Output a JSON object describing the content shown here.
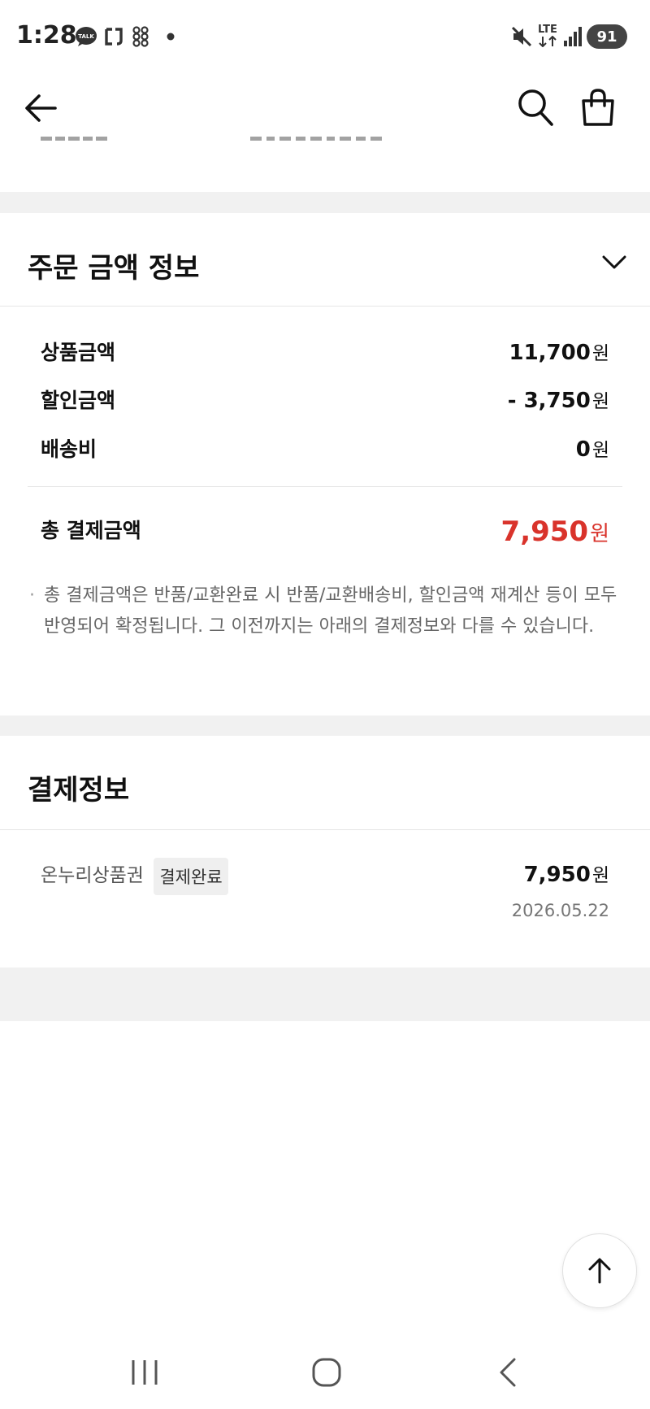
{
  "status_bar": {
    "time": "1:28",
    "talk_label": "TALK",
    "network": "LTE",
    "battery": "91"
  },
  "order_amount": {
    "title": "주문 금액 정보",
    "rows": [
      {
        "label": "상품금액",
        "value": "11,700",
        "unit": "원"
      },
      {
        "label": "할인금액",
        "value": "- 3,750",
        "unit": "원"
      },
      {
        "label": "배송비",
        "value": "0",
        "unit": "원"
      }
    ],
    "total_label": "총 결제금액",
    "total_value": "7,950",
    "total_unit": "원",
    "note": "총 결제금액은 반품/교환완료 시 반품/교환배송비, 할인금액 재계산 등이 모두 반영되어 확정됩니다. 그 이전까지는 아래의 결제정보와 다를 수 있습니다.",
    "accent_color": "#d9332b"
  },
  "payment_info": {
    "title": "결제정보",
    "method": "온누리상품권",
    "status": "결제완료",
    "amount": "7,950",
    "unit": "원",
    "date": "2026.05.22"
  },
  "icons": {
    "back": "arrow-left-icon",
    "search": "search-icon",
    "cart": "shopping-bag-icon",
    "expand": "chevron-down-icon",
    "scroll_top": "arrow-up-icon"
  }
}
